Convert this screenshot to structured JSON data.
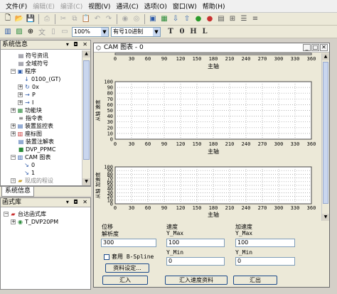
{
  "menu": [
    "文件(F)",
    "编辑(E)",
    "编译(C)",
    "视图(V)",
    "通讯(C)",
    "选项(O)",
    "窗口(W)",
    "帮助(H)"
  ],
  "toolbar2": {
    "zoom": "100%",
    "format": "有号10进制",
    "t1": "T",
    "t2": "0",
    "t3": "H",
    "t4": "L"
  },
  "sysinfo": {
    "title": "系统信息",
    "tree": [
      "符号资讯",
      "全域符号",
      "程序",
      "0100_(GT)",
      "0x",
      "P",
      "I",
      "功能块",
      "指令表",
      "装置监控表",
      "座标图",
      "装置注解表",
      "DVP_PPMC",
      "CAM 图表",
      "0",
      "1",
      "现成的程设"
    ],
    "tab": "系统信息"
  },
  "library": {
    "title": "函式库",
    "tree": [
      "台达函式库",
      "T_DVP20PM"
    ]
  },
  "cam": {
    "title": "CAM 图表 - 0",
    "x_axis_label": "主轴",
    "charts": [
      {
        "ylabel": ""
      },
      {
        "ylabel": "从轴 速度"
      },
      {
        "ylabel": "从轴 加速度"
      }
    ],
    "form": {
      "disp_group": "位移",
      "resolution_label": "解析度",
      "resolution_value": "300",
      "spline_label": "套用 B-Spline",
      "data_set_btn": "资料设定...",
      "speed_group": "速度",
      "ymax_label": "Y_Max",
      "speed_ymax": "100",
      "ymin_label": "Y_Min",
      "speed_ymin": "0",
      "acc_group": "加速度",
      "acc_ymax": "100",
      "acc_ymin": "0",
      "import_btn": "汇入",
      "import_speed_btn": "汇入速度资料",
      "export_btn": "汇出"
    }
  },
  "chart_data": [
    {
      "type": "line",
      "x": [
        0,
        30,
        60,
        90,
        120,
        150,
        180,
        210,
        240,
        270,
        300,
        330,
        360
      ],
      "xlim": [
        0,
        360
      ],
      "xlabel": "主轴",
      "series": [],
      "grid": true
    },
    {
      "type": "line",
      "x": [
        0,
        30,
        60,
        90,
        120,
        150,
        180,
        210,
        240,
        270,
        300,
        330,
        360
      ],
      "xlim": [
        0,
        360
      ],
      "xlabel": "主轴",
      "ylabel": "从轴 速度",
      "ylim": [
        0,
        100
      ],
      "yticks": [
        0,
        10,
        20,
        30,
        40,
        50,
        60,
        70,
        80,
        90,
        100
      ],
      "series": [],
      "grid": true
    },
    {
      "type": "line",
      "x": [
        0,
        30,
        60,
        90,
        120,
        150,
        180,
        210,
        240,
        270,
        300,
        330,
        360
      ],
      "xlim": [
        0,
        360
      ],
      "xlabel": "主轴",
      "ylabel": "从轴 加速度",
      "ylim": [
        0,
        100
      ],
      "yticks": [
        0,
        10,
        20,
        30,
        40,
        50,
        60,
        70,
        80,
        90,
        100
      ],
      "series": [],
      "grid": true
    }
  ]
}
